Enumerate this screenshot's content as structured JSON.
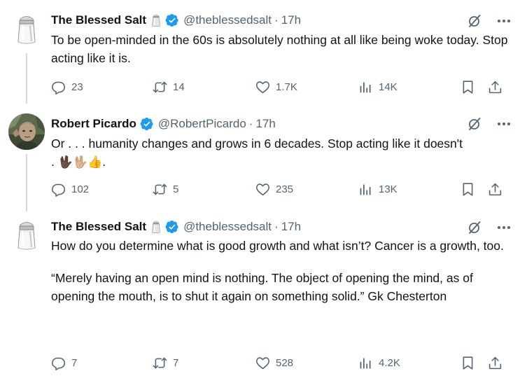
{
  "tweets": [
    {
      "name": "The Blessed Salt",
      "handle": "@theblessedsalt",
      "sep": "·",
      "time": "17h",
      "text": [
        "To be open-minded in the 60s is absolutely nothing at all like being woke today. Stop acting like it is."
      ],
      "replies": "23",
      "retweets": "14",
      "likes": "1.7K",
      "views": "14K",
      "avatar_icon": "salt-shaker-icon"
    },
    {
      "name": "Robert Picardo",
      "handle": "@RobertPicardo",
      "sep": "·",
      "time": "17h",
      "text_line1": "Or . . . humanity changes and grows in 6 decades. Stop acting like it doesn't",
      "text_line2_start": ". ",
      "emoji": "🖖🏿🖖🏼👍",
      "text_line2_end": ".",
      "replies": "102",
      "retweets": "5",
      "likes": "235",
      "views": "13K",
      "avatar_icon": "profile-photo"
    },
    {
      "name": "The Blessed Salt",
      "handle": "@theblessedsalt",
      "sep": "·",
      "time": "17h",
      "text": [
        "How do you determine what is good growth and what isn’t? Cancer is a growth, too.",
        "“Merely having an open mind is nothing. The object of opening the mind, as of opening the mouth, is to shut it again on something solid.” Gk Chesterton"
      ],
      "replies": "7",
      "retweets": "7",
      "likes": "528",
      "views": "4.2K",
      "avatar_icon": "salt-shaker-icon"
    }
  ],
  "colors": {
    "text": "#0f1419",
    "muted": "#536471",
    "verified": "#1d9bf0",
    "thread_line": "#cfd9de"
  }
}
